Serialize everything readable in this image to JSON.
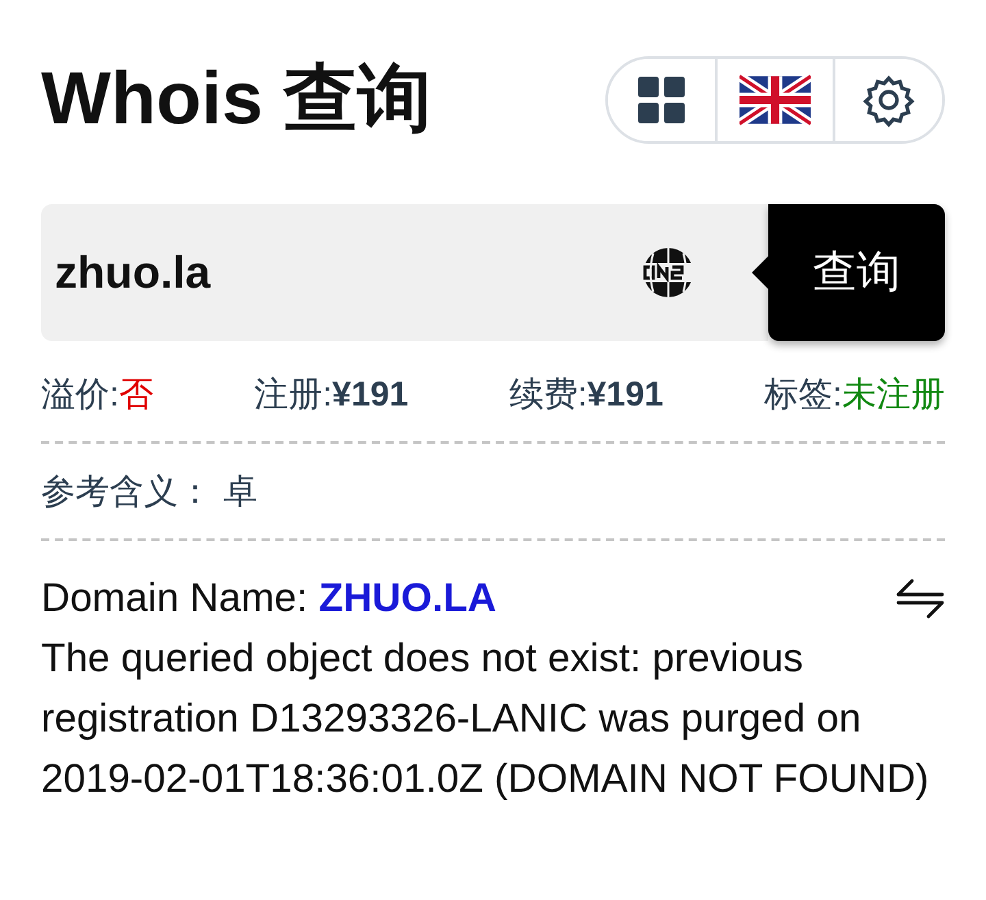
{
  "title": "Whois 查询",
  "search": {
    "value": "zhuo.la",
    "button": "查询"
  },
  "stats": [
    {
      "label": "溢价:",
      "value": "否",
      "color": "#e00000",
      "bold": false
    },
    {
      "label": "注册:",
      "value": "¥191",
      "color": "#2c3e50",
      "bold": true
    },
    {
      "label": "续费:",
      "value": "¥191",
      "color": "#2c3e50",
      "bold": true
    },
    {
      "label": "标签:",
      "value": "未注册",
      "color": "#118811",
      "bold": false
    }
  ],
  "meaning": {
    "label": "参考含义：",
    "value": "卓"
  },
  "whois": {
    "field_label": "Domain Name:",
    "field_value": "ZHUO.LA",
    "text": "The queried object does not exist: previous registration D13293326-LANIC was purged on 2019-02-01T18:36:01.0Z (DOMAIN NOT FOUND)"
  }
}
